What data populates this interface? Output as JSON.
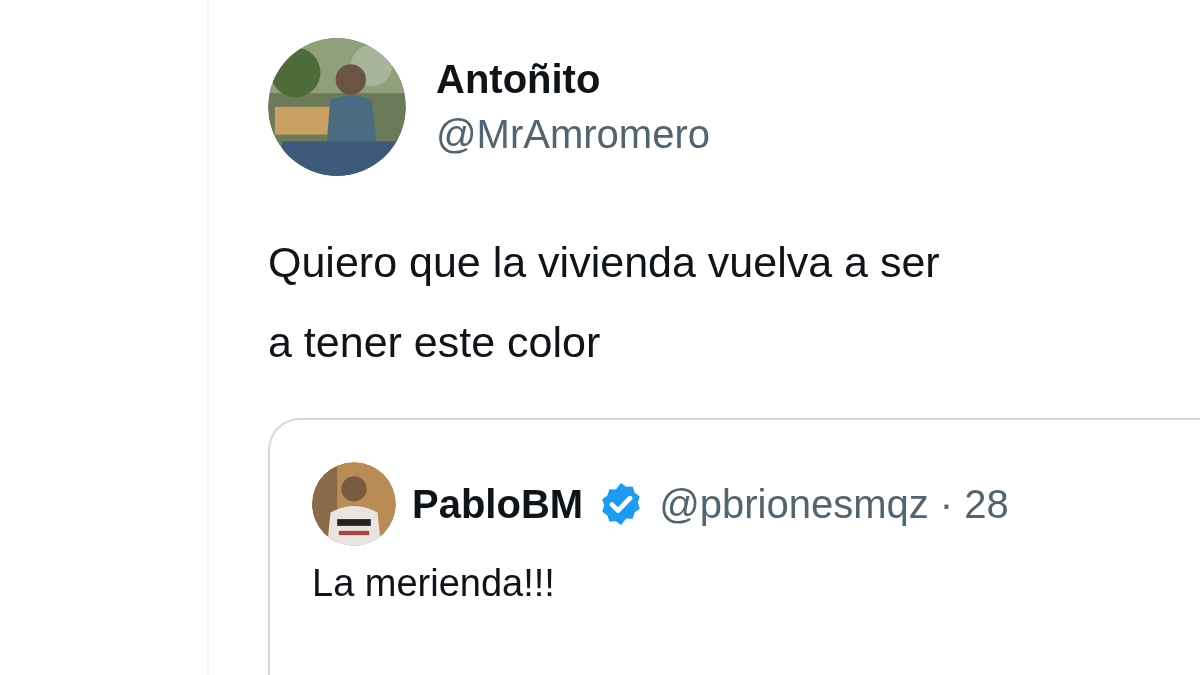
{
  "tweet": {
    "author": {
      "name": "Antoñito",
      "handle": "@MrAmromero"
    },
    "text_lines": [
      "Quiero que la vivienda vuelva a ser",
      "a tener este color"
    ],
    "quoted_tweet": {
      "author": {
        "name": "PabloBM",
        "verified": true,
        "handle_and_time": "@pbrionesmqz · 28"
      },
      "text": "La merienda!!!"
    }
  }
}
